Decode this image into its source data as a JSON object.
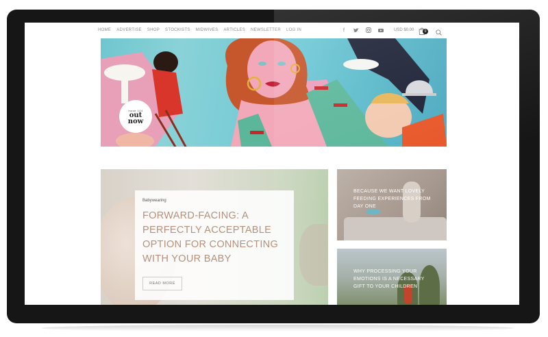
{
  "nav": {
    "items": [
      "HOME",
      "ADVERTISE",
      "SHOP",
      "STOCKISTS",
      "MIDWIVES",
      "ARTICLES",
      "NEWSLETTER",
      "LOG IN"
    ]
  },
  "social_icons": [
    "facebook-icon",
    "twitter-icon",
    "instagram-icon",
    "youtube-icon"
  ],
  "cart": {
    "label": "USD $0.00",
    "count": "0"
  },
  "hero": {
    "badge_small": "issue 104",
    "badge_line1": "out",
    "badge_line2": "now"
  },
  "feature": {
    "category": "Babywearing",
    "title": "FORWARD-FACING: A PERFECTLY ACCEPTABLE OPTION FOR CONNECTING WITH YOUR BABY",
    "button": "READ MORE"
  },
  "side_posts": [
    {
      "title": "BECAUSE WE WANT LOVELY FEEDING EXPERIENCES FROM DAY ONE"
    },
    {
      "title": "WHY PROCESSING YOUR EMOTIONS IS A NECESSARY GIFT TO YOUR CHILDREN"
    }
  ],
  "colors": {
    "title_accent": "#b5907c",
    "frame": "#161616",
    "hero_teal": "#6fc6cf"
  }
}
